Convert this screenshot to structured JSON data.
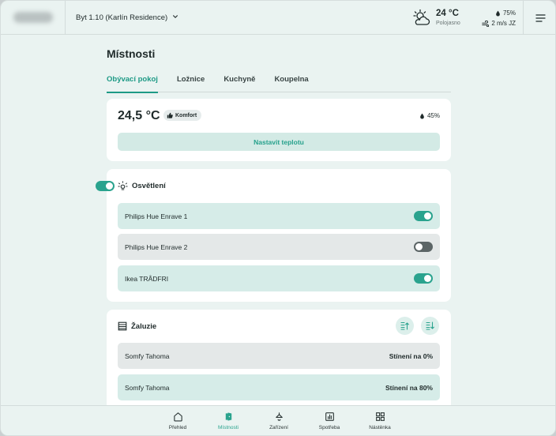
{
  "header": {
    "property": "Byt 1.10 (Karlín Residence)",
    "weather": {
      "temp": "24 °C",
      "condition": "Polojasno",
      "humidity": "75%",
      "wind": "2 m/s JZ"
    }
  },
  "page": {
    "title": "Místnosti",
    "tabs": [
      {
        "label": "Obývací pokoj",
        "active": true
      },
      {
        "label": "Ložnice",
        "active": false
      },
      {
        "label": "Kuchyně",
        "active": false
      },
      {
        "label": "Koupelna",
        "active": false
      }
    ]
  },
  "climate": {
    "temperature": "24,5 °C",
    "badge": "Komfort",
    "humidity": "45%",
    "button": "Nastavit teplotu"
  },
  "lighting": {
    "title": "Osvětlení",
    "master_on": true,
    "items": [
      {
        "label": "Philips Hue Enrave 1",
        "on": true
      },
      {
        "label": "Philips Hue Enrave 2",
        "on": false
      },
      {
        "label": "Ikea TRÅDFRI",
        "on": true
      }
    ]
  },
  "blinds": {
    "title": "Žaluzie",
    "items": [
      {
        "label": "Somfy Tahoma",
        "status": "Stínení na 0%"
      },
      {
        "label": "Somfy Tahoma",
        "status": "Stínení na 80%"
      }
    ]
  },
  "nav": [
    {
      "label": "Přehled",
      "icon": "home-icon",
      "active": false
    },
    {
      "label": "Místnosti",
      "icon": "door-icon",
      "active": true
    },
    {
      "label": "Zařízení",
      "icon": "lamp-icon",
      "active": false
    },
    {
      "label": "Spotřeba",
      "icon": "chart-icon",
      "active": false
    },
    {
      "label": "Nástěnka",
      "icon": "grid-icon",
      "active": false
    }
  ],
  "colors": {
    "accent": "#2aa38e",
    "background": "#eaf3f1",
    "row_on": "#d6ece8",
    "row_off": "#e4e8e8"
  }
}
